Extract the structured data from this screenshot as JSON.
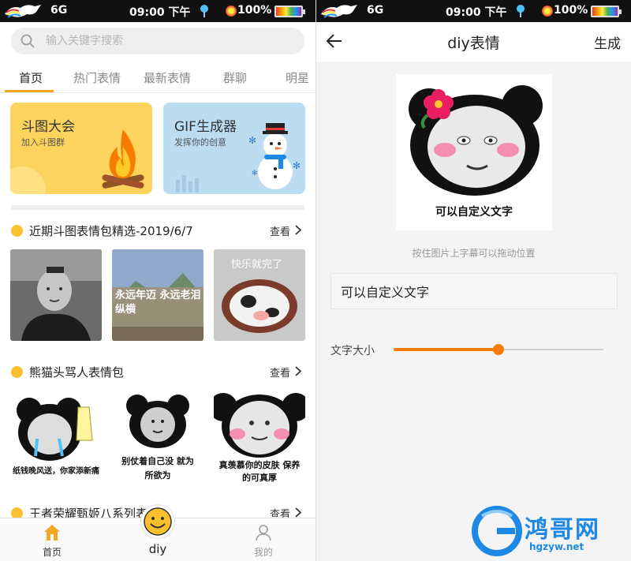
{
  "status_bar": {
    "network": "6G",
    "time": "09:00 下午",
    "battery_percent": "100%"
  },
  "home": {
    "search": {
      "placeholder": "输入关键字搜索"
    },
    "tabs": [
      {
        "label": "首页",
        "active": true
      },
      {
        "label": "热门表情",
        "active": false
      },
      {
        "label": "最新表情",
        "active": false
      },
      {
        "label": "群聊",
        "active": false
      },
      {
        "label": "明星",
        "active": false
      }
    ],
    "banners": [
      {
        "title": "斗图大会",
        "subtitle": "加入斗图群",
        "icon": "campfire-icon",
        "color": "#fcd35c"
      },
      {
        "title": "GIF生成器",
        "subtitle": "发挥你的创意",
        "icon": "snowman-icon",
        "color": "#bcdcf2"
      }
    ],
    "sections": [
      {
        "title": "近期斗图表情包精选-2019/6/7",
        "more_label": "查看",
        "items": [
          {
            "caption": ""
          },
          {
            "caption": "永远年迈 永远老泪纵横"
          },
          {
            "caption": "快乐就完了"
          }
        ]
      },
      {
        "title": "熊猫头骂人表情包",
        "more_label": "查看",
        "items": [
          {
            "caption": "纸钱晚风送，你家添新痛"
          },
          {
            "caption": "别仗着自己没 就为所欲为"
          },
          {
            "caption": "真羡慕你的皮肤 保养的可真厚"
          }
        ]
      },
      {
        "title": "王者荣耀甄姬八系列表情包",
        "more_label": "查看"
      }
    ],
    "bottom_nav": [
      {
        "label": "首页",
        "icon": "home-icon",
        "active": true
      },
      {
        "label": "diy",
        "icon": "smiley-icon",
        "active": false
      },
      {
        "label": "我的",
        "icon": "user-icon",
        "active": false
      }
    ],
    "accent_color": "#f5a623"
  },
  "diy": {
    "title": "diy表情",
    "action_label": "生成",
    "image_caption": "可以自定义文字",
    "hint": "按住图片上字幕可以拖动位置",
    "text_input_value": "可以自定义文字",
    "font_size_label": "文字大小",
    "font_size_fraction": 0.5,
    "slider_color": "#f57c00"
  },
  "watermark": {
    "name": "鸿哥网",
    "url": "hgzyw.net"
  }
}
